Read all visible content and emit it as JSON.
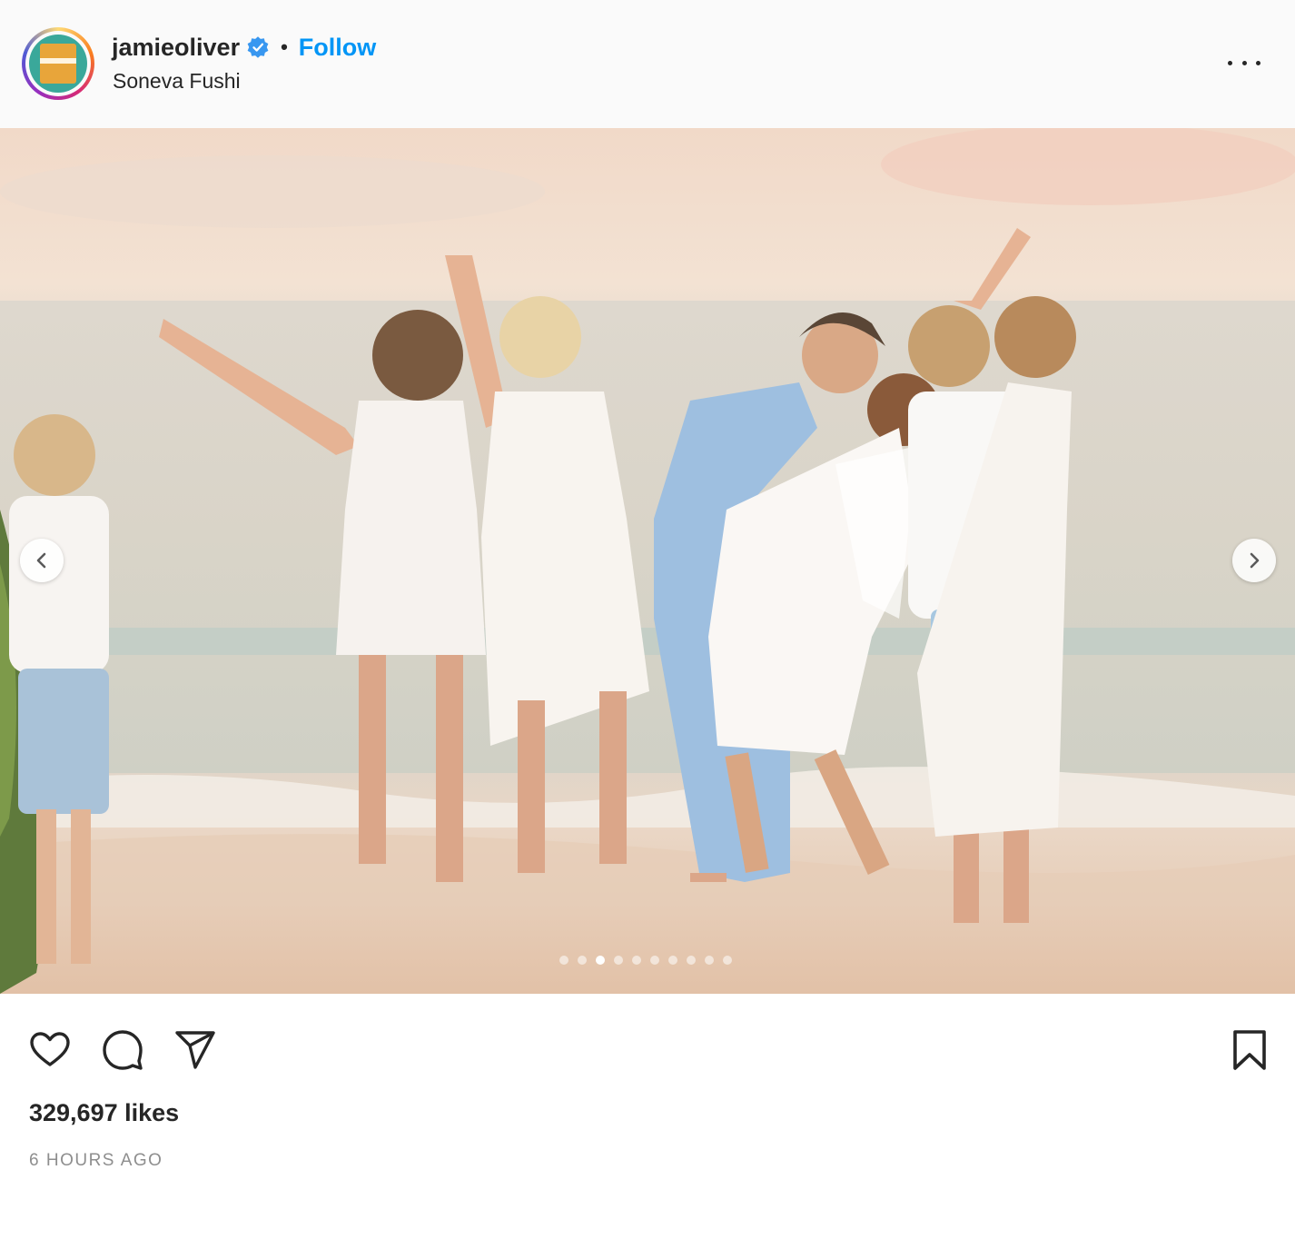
{
  "post": {
    "username": "jamieoliver",
    "verified": true,
    "separator": "•",
    "follow_label": "Follow",
    "location": "Soneva Fushi",
    "likes": "329,697 likes",
    "timestamp": "6 HOURS AGO"
  },
  "carousel": {
    "total_slides": 10,
    "active_slide": 3
  },
  "icons": {
    "more": "more-options-icon",
    "like": "heart-icon",
    "comment": "comment-bubble-icon",
    "share": "paper-plane-icon",
    "save": "bookmark-icon",
    "prev": "chevron-left-icon",
    "next": "chevron-right-icon",
    "verified": "verified-badge-icon"
  },
  "colors": {
    "follow_blue": "#0095f6",
    "verified_blue": "#3897f0",
    "text": "#262626",
    "muted": "#8e8e8e",
    "header_bg": "#fafafa"
  }
}
